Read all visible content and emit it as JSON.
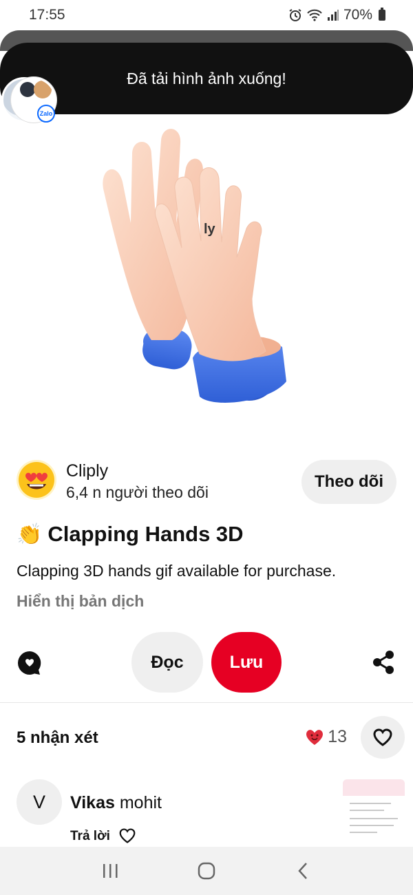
{
  "status_bar": {
    "time": "17:55",
    "battery": "70%",
    "icons": [
      "alarm-icon",
      "wifi-icon",
      "signal-icon",
      "battery-icon"
    ]
  },
  "toast": {
    "message": "Đã tải hình ảnh xuống!",
    "share_badge": "Zalo"
  },
  "pin": {
    "image_watermark": "ly",
    "creator": {
      "name": "Cliply",
      "followers": "6,4 n người theo dõi",
      "avatar_icon": "heart-eyes-emoji"
    },
    "follow_label": "Theo dõi",
    "title_emoji": "👏",
    "title": "Clapping Hands 3D",
    "description": "Clapping 3D hands gif available for purchase.",
    "translate_label": "Hiển thị bản dịch"
  },
  "actions": {
    "read_label": "Đọc",
    "save_label": "Lưu",
    "comment_icon": "comment-icon",
    "share_icon": "share-icon"
  },
  "comments": {
    "count_label": "5 nhận xét",
    "reaction_count": "13",
    "items": [
      {
        "avatar_letter": "V",
        "first_name": "Vikas",
        "last_name": "mohit",
        "reply_label": "Trả lời"
      }
    ]
  },
  "colors": {
    "save_red": "#e60023",
    "toast_bg": "#111111",
    "cuff_blue": "#3b6fe0"
  }
}
